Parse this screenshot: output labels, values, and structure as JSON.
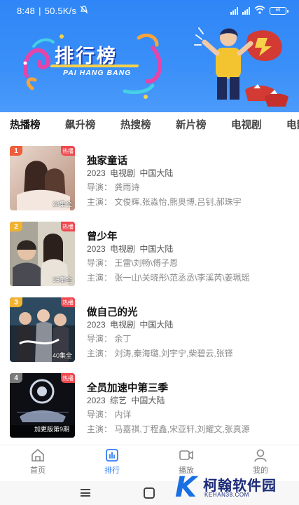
{
  "status": {
    "time": "8:48",
    "speed": "50.5K/s",
    "battery": "69"
  },
  "hero": {
    "title": "排行榜",
    "subtitle": "PAI HANG BANG"
  },
  "tabs": [
    "热播榜",
    "飙升榜",
    "热搜榜",
    "新片榜",
    "电视剧",
    "电影"
  ],
  "items": [
    {
      "rank": "1",
      "badge": "热播",
      "episodes": "28集全",
      "title": "独家童话",
      "meta": "2023  电视剧  中国大陆",
      "director": "导演：  龚雨诗",
      "cast": "主演：  文俊辉,张淼怡,熊奥博,吕钊,郝珠宇",
      "rank_color": "#f05d3b",
      "poster_colors": [
        "#c9a797",
        "#6d4a3e"
      ]
    },
    {
      "rank": "2",
      "badge": "热播",
      "episodes": "35集全",
      "title": "曾少年",
      "meta": "2023  电视剧  中国大陆",
      "director": "导演：  王雷\\刘畅\\傅子恩",
      "cast": "主演：  张一山\\关晓彤\\范丞丞\\李溪芮\\姜珮瑶",
      "rank_color": "#f1b232",
      "poster_colors": [
        "#c8c3b4",
        "#3f3a35"
      ]
    },
    {
      "rank": "3",
      "badge": "热播",
      "episodes": "40集全",
      "title": "做自己的光",
      "meta": "2023  电视剧  中国大陆",
      "director": "导演：  余丁",
      "cast": "主演：  刘涛,秦海璐,刘宇宁,柴碧云,张铎",
      "rank_color": "#f0b332",
      "poster_colors": [
        "#2f4a5e",
        "#151c24"
      ]
    },
    {
      "rank": "4",
      "badge": "热播",
      "episodes": "加更版第9期",
      "title": "全员加速中第三季",
      "meta": "2023  综艺  中国大陆",
      "director": "导演：  内详",
      "cast": "主演：  马嘉祺,丁程鑫,宋亚轩,刘耀文,张真源",
      "rank_color": "#7a7a7a",
      "poster_colors": [
        "#2b2c33",
        "#08090c"
      ]
    }
  ],
  "nav": [
    {
      "label": "首页",
      "icon": "home-icon"
    },
    {
      "label": "排行",
      "icon": "rank-icon"
    },
    {
      "label": "播放",
      "icon": "video-icon"
    },
    {
      "label": "我的",
      "icon": "user-icon"
    }
  ],
  "watermark": {
    "k": "K",
    "text": "柯翰软件园",
    "sub": "KEHAN38.COM"
  },
  "colors": {
    "hero": "#3a8ff8",
    "accent": "#2f7df6",
    "hot": "#f0484f"
  }
}
